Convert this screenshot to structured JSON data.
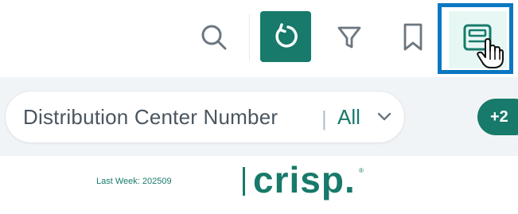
{
  "toolbar": {
    "search_icon": "search-icon",
    "refresh_icon": "refresh-icon",
    "filter_icon": "filter-icon",
    "bookmark_icon": "bookmark-icon",
    "dashboard_icon": "dashboard-icon",
    "accent_color": "#177a6a",
    "highlight_color": "#0b78c2"
  },
  "filters": {
    "distribution_center": {
      "label": "Distribution Center Number",
      "separator": "|",
      "value": "All"
    },
    "more_count": "+2"
  },
  "footer": {
    "last_week": "Last Week: 202509",
    "logo_text": "crisp.",
    "logo_mark": "®"
  }
}
